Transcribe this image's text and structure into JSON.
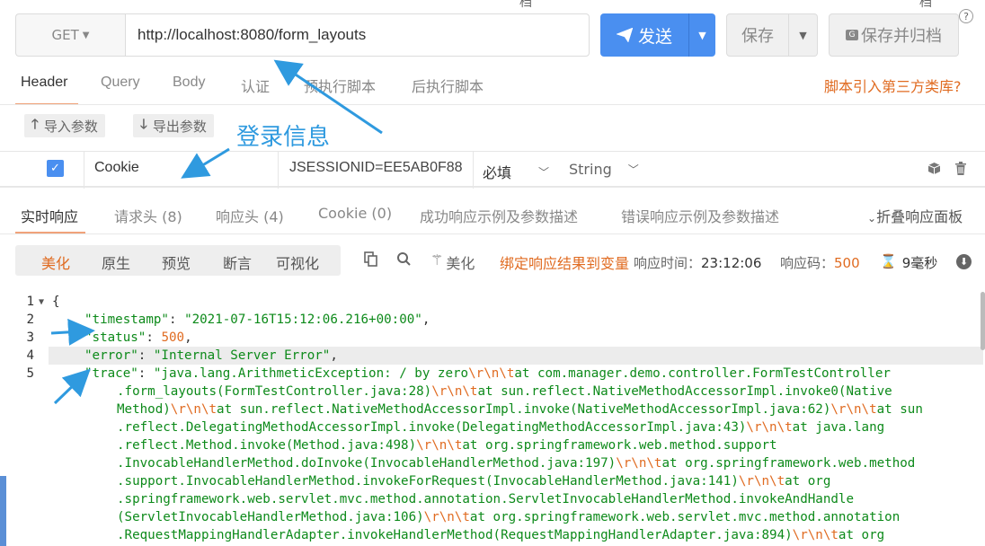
{
  "request": {
    "method": "GET",
    "url": "http://localhost:8080/form_layouts",
    "send_label": "发送",
    "save_label": "保存",
    "archive_label": "保存并归档",
    "help": "?",
    "cutoff_top_1": "档",
    "cutoff_top_2": "档"
  },
  "tabs": [
    "Header",
    "Query",
    "Body",
    "认证",
    "预执行脚本",
    "后执行脚本"
  ],
  "third_party_link": "脚本引入第三方类库?",
  "import_label": "导入参数",
  "export_label": "导出参数",
  "annotation": "登录信息",
  "param_row": {
    "enabled": true,
    "key": "Cookie",
    "value": "JSESSIONID=EE5AB0F88",
    "required": "必填",
    "type": "String"
  },
  "response_tabs": [
    "实时响应",
    "请求头 (8)",
    "响应头 (4)",
    "Cookie (0)",
    "成功响应示例及参数描述",
    "错误响应示例及参数描述"
  ],
  "collapse_label": "折叠响应面板",
  "view_modes": [
    "美化",
    "原生",
    "预览",
    "断言",
    "可视化"
  ],
  "beautify_label": "美化",
  "bind_label": "绑定响应结果到变量",
  "response_time_label": "响应时间：",
  "response_time": "23:12:06",
  "status_code_label": "响应码：",
  "status_code": "500",
  "duration": "9毫秒",
  "code_lines": [
    {
      "ln": "1",
      "fold": true
    },
    {
      "ln": "2"
    },
    {
      "ln": "3"
    },
    {
      "ln": "4"
    },
    {
      "ln": "5"
    }
  ],
  "json": {
    "open_brace": "{",
    "timestamp_key": "\"timestamp\"",
    "timestamp_val": "\"2021-07-16T15:12:06.216+00:00\"",
    "status_key": "\"status\"",
    "status_val": "500",
    "error_key": "\"error\"",
    "error_val": "\"Internal Server Error\"",
    "trace_key": "\"trace\"",
    "trace_lines": [
      "\"java.lang.ArithmeticException: / by zero\\r\\n\\tat com.manager.demo.controller.FormTestController",
      ".form_layouts(FormTestController.java:28)\\r\\n\\tat sun.reflect.NativeMethodAccessorImpl.invoke0(Native",
      "Method)\\r\\n\\tat sun.reflect.NativeMethodAccessorImpl.invoke(NativeMethodAccessorImpl.java:62)\\r\\n\\tat sun",
      ".reflect.DelegatingMethodAccessorImpl.invoke(DelegatingMethodAccessorImpl.java:43)\\r\\n\\tat java.lang",
      ".reflect.Method.invoke(Method.java:498)\\r\\n\\tat org.springframework.web.method.support",
      ".InvocableHandlerMethod.doInvoke(InvocableHandlerMethod.java:197)\\r\\n\\tat org.springframework.web.method",
      ".support.InvocableHandlerMethod.invokeForRequest(InvocableHandlerMethod.java:141)\\r\\n\\tat org",
      ".springframework.web.servlet.mvc.method.annotation.ServletInvocableHandlerMethod.invokeAndHandle",
      "(ServletInvocableHandlerMethod.java:106)\\r\\n\\tat org.springframework.web.servlet.mvc.method.annotation",
      ".RequestMappingHandlerAdapter.invokeHandlerMethod(RequestMappingHandlerAdapter.java:894)\\r\\n\\tat org"
    ]
  },
  "colors": {
    "accent_blue": "#4a8ff0",
    "orange": "#e06b21",
    "json_green": "#0d8a1a",
    "annotation_blue": "#2f9adf"
  }
}
